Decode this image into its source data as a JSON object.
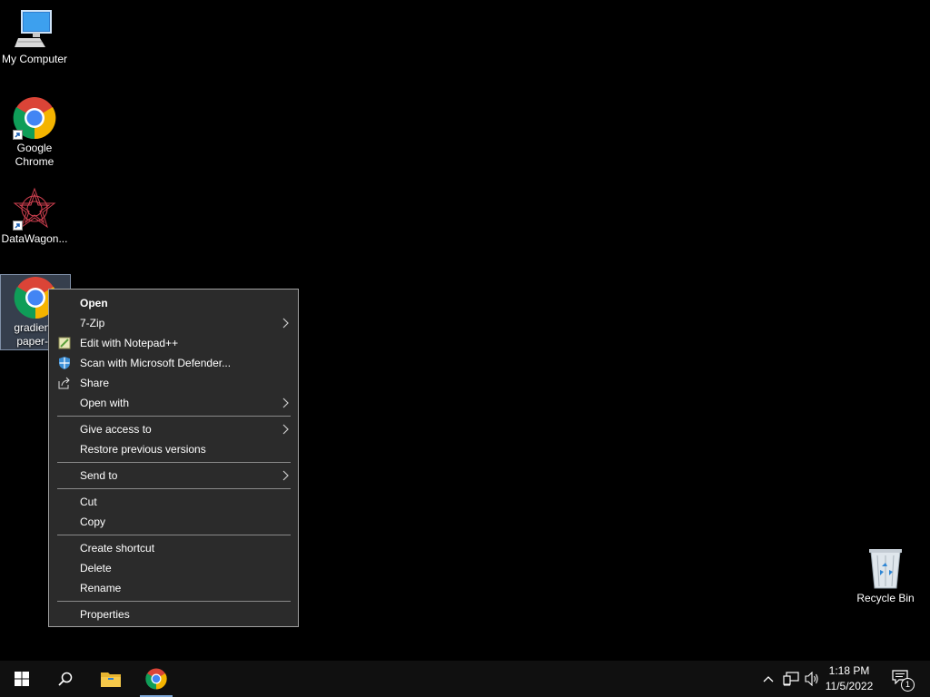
{
  "desktop": {
    "icons": [
      {
        "label": "My Computer"
      },
      {
        "label": "Google Chrome"
      },
      {
        "label": "DataWagon..."
      },
      {
        "label": "gradient-paper-4"
      },
      {
        "label": "Recycle Bin"
      }
    ],
    "selected_icon_lines": [
      "gradient-",
      "paper-4"
    ]
  },
  "context_menu": {
    "items": [
      {
        "label": "Open",
        "icon": null,
        "submenu": false,
        "bold": true
      },
      {
        "label": "7-Zip",
        "icon": null,
        "submenu": true
      },
      {
        "label": "Edit with Notepad++",
        "icon": "notepadpp-icon",
        "submenu": false
      },
      {
        "label": "Scan with Microsoft Defender...",
        "icon": "defender-icon",
        "submenu": false
      },
      {
        "label": "Share",
        "icon": "share-icon",
        "submenu": false
      },
      {
        "label": "Open with",
        "icon": null,
        "submenu": true
      },
      {
        "label": "Give access to",
        "icon": null,
        "submenu": true
      },
      {
        "label": "Restore previous versions",
        "icon": null,
        "submenu": false
      },
      {
        "label": "Send to",
        "icon": null,
        "submenu": true
      },
      {
        "label": "Cut",
        "icon": null,
        "submenu": false
      },
      {
        "label": "Copy",
        "icon": null,
        "submenu": false
      },
      {
        "label": "Create shortcut",
        "icon": null,
        "submenu": false
      },
      {
        "label": "Delete",
        "icon": null,
        "submenu": false
      },
      {
        "label": "Rename",
        "icon": null,
        "submenu": false
      },
      {
        "label": "Properties",
        "icon": null,
        "submenu": false
      }
    ]
  },
  "taskbar": {
    "pinned": [
      "start-icon",
      "search-icon",
      "file-explorer-icon",
      "chrome-icon"
    ],
    "clock": {
      "time": "1:18 PM",
      "date": "11/5/2022"
    },
    "notification_count": "1"
  },
  "colors": {
    "desktop_bg": "#000000",
    "menu_bg": "#2b2b2b",
    "taskbar_bg": "#101010",
    "accent": "#7fa8d8"
  }
}
